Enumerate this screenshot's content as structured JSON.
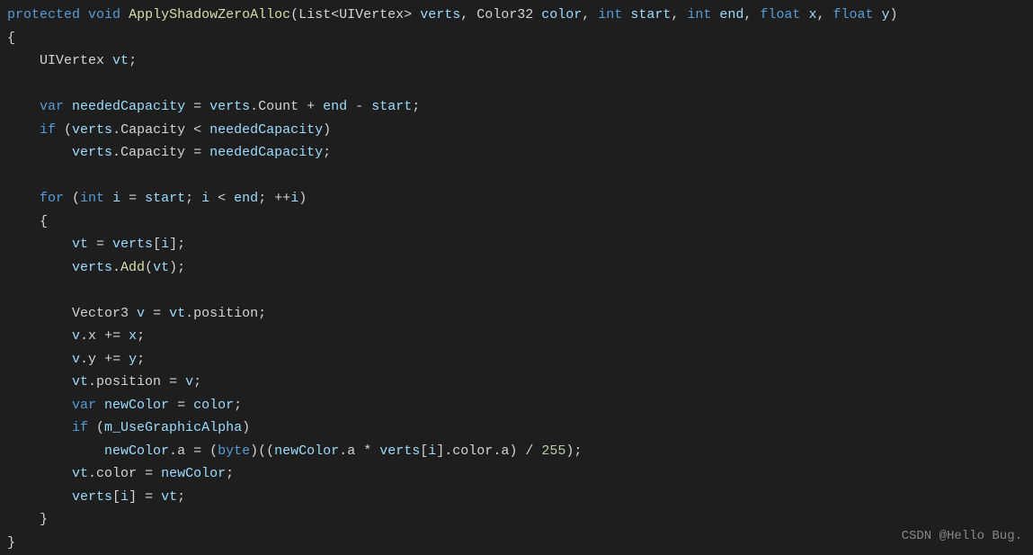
{
  "code": {
    "line1": {
      "protected": "protected",
      "void": "void",
      "method": "ApplyShadowZeroAlloc",
      "lparen": "(",
      "list": "List",
      "lt": "<",
      "uivertex": "UIVertex",
      "gt": ">",
      "verts": "verts",
      "comma1": ", ",
      "color32": "Color32",
      "color": "color",
      "comma2": ", ",
      "int1": "int",
      "start": "start",
      "comma3": ", ",
      "int2": "int",
      "end": "end",
      "comma4": ", ",
      "float1": "float",
      "x": "x",
      "comma5": ", ",
      "float2": "float",
      "y": "y",
      "rparen": ")"
    },
    "line2": "{",
    "line3": {
      "indent": "    ",
      "uivertex": "UIVertex",
      "space": " ",
      "vt": "vt",
      "semi": ";"
    },
    "line5": {
      "indent": "    ",
      "var": "var",
      "needed": "neededCapacity",
      "eq": " = ",
      "verts": "verts",
      "dot": ".",
      "count": "Count",
      "plus": " + ",
      "end": "end",
      "minus": " - ",
      "start": "start",
      "semi": ";"
    },
    "line6": {
      "indent": "    ",
      "if": "if",
      "lparen": " (",
      "verts": "verts",
      "dot": ".",
      "capacity": "Capacity",
      "lt": " < ",
      "needed": "neededCapacity",
      "rparen": ")"
    },
    "line7": {
      "indent": "        ",
      "verts": "verts",
      "dot": ".",
      "capacity": "Capacity",
      "eq": " = ",
      "needed": "neededCapacity",
      "semi": ";"
    },
    "line9": {
      "indent": "    ",
      "for": "for",
      "lparen": " (",
      "int": "int",
      "i": "i",
      "eq": " = ",
      "start": "start",
      "semi1": "; ",
      "i2": "i",
      "lt": " < ",
      "end": "end",
      "semi2": "; ",
      "inc": "++",
      "i3": "i",
      "rparen": ")"
    },
    "line10": {
      "indent": "    ",
      "brace": "{"
    },
    "line11": {
      "indent": "        ",
      "vt": "vt",
      "eq": " = ",
      "verts": "verts",
      "lb": "[",
      "i": "i",
      "rb": "]",
      "semi": ";"
    },
    "line12": {
      "indent": "        ",
      "verts": "verts",
      "dot": ".",
      "add": "Add",
      "lparen": "(",
      "vt": "vt",
      "rparen": ")",
      "semi": ";"
    },
    "line14": {
      "indent": "        ",
      "vector3": "Vector3",
      "v": "v",
      "eq": " = ",
      "vt": "vt",
      "dot": ".",
      "position": "position",
      "semi": ";"
    },
    "line15": {
      "indent": "        ",
      "v": "v",
      "dot": ".",
      "x": "x",
      "pluseq": " += ",
      "x2": "x",
      "semi": ";"
    },
    "line16": {
      "indent": "        ",
      "v": "v",
      "dot": ".",
      "y": "y",
      "pluseq": " += ",
      "y2": "y",
      "semi": ";"
    },
    "line17": {
      "indent": "        ",
      "vt": "vt",
      "dot": ".",
      "position": "position",
      "eq": " = ",
      "v": "v",
      "semi": ";"
    },
    "line18": {
      "indent": "        ",
      "var": "var",
      "newColor": "newColor",
      "eq": " = ",
      "color": "color",
      "semi": ";"
    },
    "line19": {
      "indent": "        ",
      "if": "if",
      "lparen": " (",
      "field": "m_UseGraphicAlpha",
      "rparen": ")"
    },
    "line20": {
      "indent": "            ",
      "newColor": "newColor",
      "dot": ".",
      "a": "a",
      "eq": " = ",
      "lparen1": "(",
      "byte": "byte",
      "rparen1": ")",
      "lparen2": "((",
      "newColor2": "newColor",
      "dot2": ".",
      "a2": "a",
      "mult": " * ",
      "verts": "verts",
      "lb": "[",
      "i": "i",
      "rb": "]",
      "dot3": ".",
      "colorm": "color",
      "dot4": ".",
      "a3": "a",
      "rparen2": ")",
      "div": " / ",
      "num": "255",
      "rparen3": ")",
      "semi": ";"
    },
    "line21": {
      "indent": "        ",
      "vt": "vt",
      "dot": ".",
      "colorm": "color",
      "eq": " = ",
      "newColor": "newColor",
      "semi": ";"
    },
    "line22": {
      "indent": "        ",
      "verts": "verts",
      "lb": "[",
      "i": "i",
      "rb": "]",
      "eq": " = ",
      "vt": "vt",
      "semi": ";"
    },
    "line23": {
      "indent": "    ",
      "brace": "}"
    },
    "line24": "}"
  },
  "watermark": "CSDN @Hello Bug."
}
